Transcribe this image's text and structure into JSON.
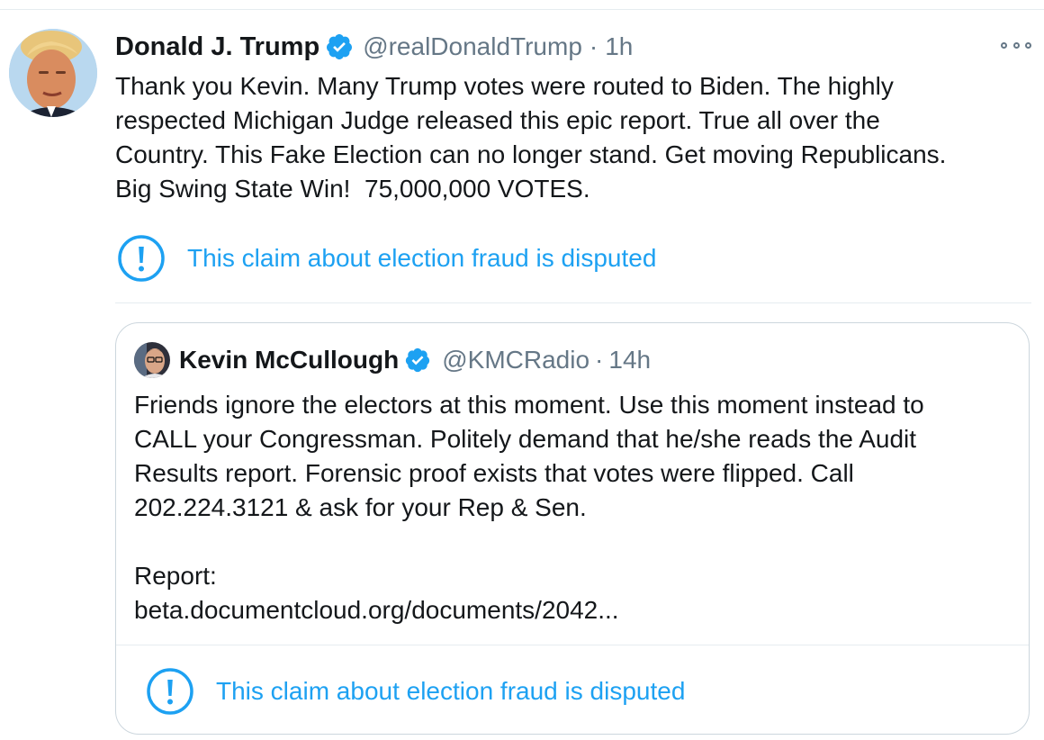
{
  "tweet": {
    "author_name": "Donald J. Trump",
    "handle": "@realDonaldTrump",
    "separator": "·",
    "time": "1h",
    "text": "Thank you Kevin. Many Trump votes were routed to Biden. The highly\nrespected Michigan Judge released this epic report. True all over the\nCountry. This Fake Election can no longer stand. Get moving Republicans.\nBig Swing State Win!  75,000,000 VOTES.",
    "notice": "This claim about election fraud is disputed",
    "icons": {
      "verified": "verified-badge-icon",
      "more": "more-options-icon",
      "notice": "exclamation-circle-icon"
    }
  },
  "quoted_tweet": {
    "author_name": "Kevin McCullough",
    "handle": "@KMCRadio",
    "separator": "·",
    "time": "14h",
    "text": "Friends ignore the electors at this moment. Use this moment instead to\nCALL your Congressman. Politely demand that he/she reads the Audit\nResults report. Forensic proof exists that votes were flipped. Call\n202.224.3121 & ask for your Rep & Sen.\n\nReport:\nbeta.documentcloud.org/documents/2042...",
    "notice": "This claim about election fraud is disputed"
  },
  "colors": {
    "accent": "#1da1f2",
    "text": "#14171a",
    "muted": "#657786",
    "divider": "#e6ecf0"
  }
}
